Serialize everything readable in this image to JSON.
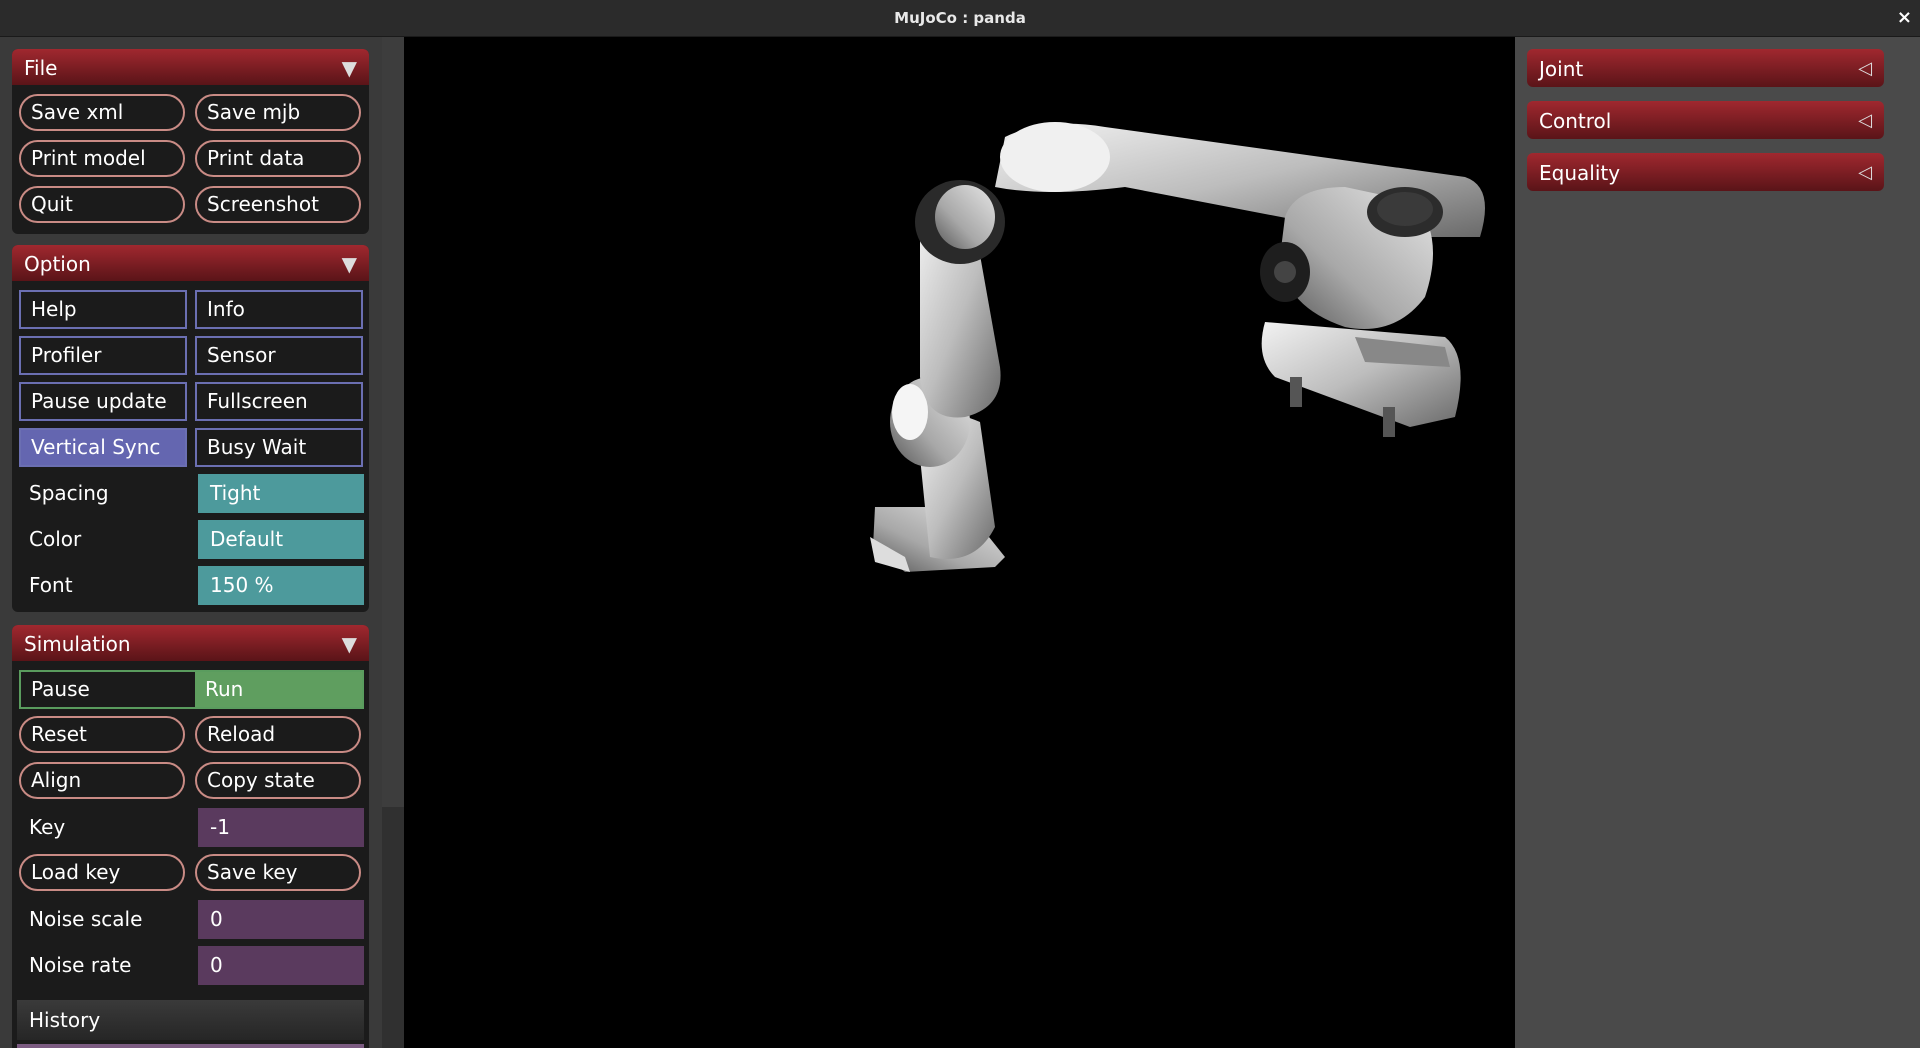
{
  "window": {
    "title": "MuJoCo : panda",
    "close_glyph": "×"
  },
  "file": {
    "header": "File",
    "save_xml": "Save xml",
    "save_mjb": "Save mjb",
    "print_model": "Print model",
    "print_data": "Print data",
    "quit": "Quit",
    "screenshot": "Screenshot"
  },
  "option": {
    "header": "Option",
    "help": "Help",
    "info": "Info",
    "profiler": "Profiler",
    "sensor": "Sensor",
    "pause_update": "Pause update",
    "fullscreen": "Fullscreen",
    "vertical_sync": "Vertical Sync",
    "busy_wait": "Busy Wait",
    "vertical_sync_on": true,
    "spacing_label": "Spacing",
    "spacing_value": "Tight",
    "color_label": "Color",
    "color_value": "Default",
    "font_label": "Font",
    "font_value": "150 %"
  },
  "simulation": {
    "header": "Simulation",
    "pause": "Pause",
    "run": "Run",
    "selected": "Run",
    "reset": "Reset",
    "reload": "Reload",
    "align": "Align",
    "copy_state": "Copy state",
    "key_label": "Key",
    "key_value": "-1",
    "load_key": "Load key",
    "save_key": "Save key",
    "noise_scale_label": "Noise scale",
    "noise_scale_value": "0",
    "noise_rate_label": "Noise rate",
    "noise_rate_value": "0"
  },
  "history": {
    "header": "History"
  },
  "right": {
    "joint": "Joint",
    "control": "Control",
    "equality": "Equality"
  },
  "icons": {
    "expanded": "triangle-down-icon",
    "collapsed": "triangle-left-icon"
  },
  "colors": {
    "header_red": "#a0282f",
    "button_outline": "#c98b85",
    "checkbox_outline": "#6b6fb2",
    "checkbox_on": "#6466b0",
    "select_teal": "#4d9a9c",
    "edit_purple": "#5a3a5e",
    "radio_green": "#5f9e5f",
    "right_panel": "#4a4a4a"
  }
}
